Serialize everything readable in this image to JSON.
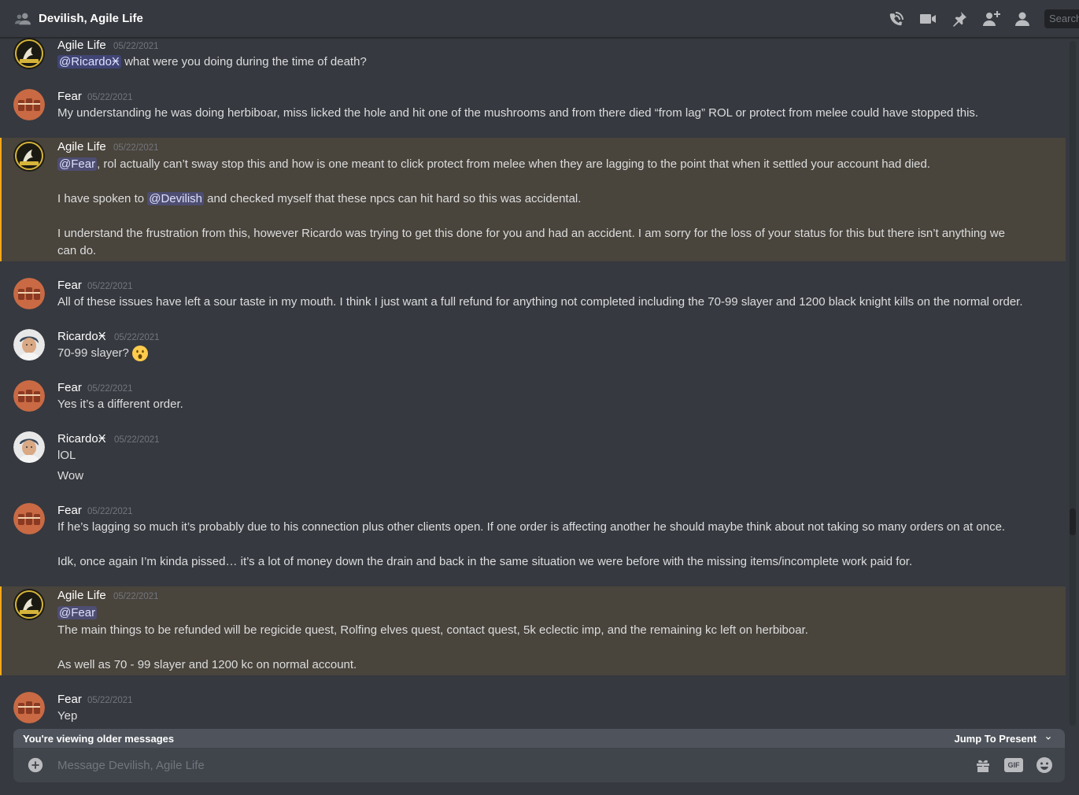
{
  "channel": {
    "title": "Devilish, Agile Life",
    "search_placeholder": "Search"
  },
  "header_icons": [
    "phone-call-icon",
    "video-call-icon",
    "pin-icon",
    "add-friend-icon",
    "member-list-icon"
  ],
  "messages": [
    {
      "author": "Agile Life",
      "timestamp": "05/22/2021",
      "avatar": "agile-life",
      "lines": [
        {
          "mention": "@RicardoӾ",
          "text": " what were you doing during the time of death?"
        }
      ]
    },
    {
      "author": "Fear",
      "timestamp": "05/22/2021",
      "avatar": "fear",
      "lines": [
        {
          "text": "My understanding he was doing herbiboar, miss licked the hole and hit one of the mushrooms and from there died “from lag” ROL or protect from melee could have stopped this."
        }
      ]
    },
    {
      "author": "Agile Life",
      "timestamp": "05/22/2021",
      "avatar": "agile-life",
      "highlighted": true,
      "lines": [
        {
          "mention": "@Fear",
          "text": ", rol actually can’t sway stop this and how is one meant to click protect from melee when they are lagging to the point that when it settled your account had died."
        },
        {
          "pre": "I have spoken to ",
          "mention": "@Devilish",
          "text": " and checked myself that these npcs can hit hard so this was accidental."
        },
        {
          "text": "I understand the frustration from this, however Ricardo was trying to get this done for you and had an accident. I am sorry for the loss of your status for this but there isn’t anything we can do."
        }
      ]
    },
    {
      "author": "Fear",
      "timestamp": "05/22/2021",
      "avatar": "fear",
      "lines": [
        {
          "text": "All of these issues have left a sour taste in my mouth. I think I just want a full refund for anything not completed including the 70-99 slayer and 1200 black knight kills on the normal order."
        }
      ]
    },
    {
      "author": "RicardoӾ",
      "timestamp": "05/22/2021",
      "avatar": "ricardo",
      "lines": [
        {
          "text": "70-99 slayer?",
          "emoji": "hushed-face-emoji"
        }
      ]
    },
    {
      "author": "Fear",
      "timestamp": "05/22/2021",
      "avatar": "fear",
      "lines": [
        {
          "text": "Yes it’s a different order."
        }
      ]
    },
    {
      "author": "RicardoӾ",
      "timestamp": "05/22/2021",
      "avatar": "ricardo",
      "lines": [
        {
          "text": "lOL"
        },
        {
          "text": "Wow"
        }
      ]
    },
    {
      "author": "Fear",
      "timestamp": "05/22/2021",
      "avatar": "fear",
      "lines": [
        {
          "text": "If he’s lagging so much it’s probably due to his connection plus other clients open. If one order is affecting another he should maybe think about not taking so many orders on at once."
        },
        {
          "text": "Idk, once again I’m kinda pissed… it’s a lot of money down the drain and back in the same situation we were before with the missing items/incomplete work paid for."
        }
      ]
    },
    {
      "author": "Agile Life",
      "timestamp": "05/22/2021",
      "avatar": "agile-life",
      "highlighted": true,
      "lines": [
        {
          "mention": "@Fear",
          "text": ""
        },
        {
          "text": "The main things to be refunded will be regicide quest, Rolfing elves quest, contact quest, 5k eclectic imp, and the remaining kc left on herbiboar."
        },
        {
          "text": "As well as 70 - 99 slayer and 1200 kc on normal account."
        }
      ]
    },
    {
      "author": "Fear",
      "timestamp": "05/22/2021",
      "avatar": "fear",
      "lines": [
        {
          "text": "Yep"
        }
      ]
    }
  ],
  "older_banner": {
    "text": "You're viewing older messages",
    "jump_label": "Jump To Present"
  },
  "composer": {
    "placeholder": "Message Devilish, Agile Life",
    "gif_label": "GIF"
  },
  "colors": {
    "background": "#36393f",
    "mention_highlight": "#49443c",
    "mention_bar": "#faa81a",
    "timestamp": "#72767d"
  }
}
